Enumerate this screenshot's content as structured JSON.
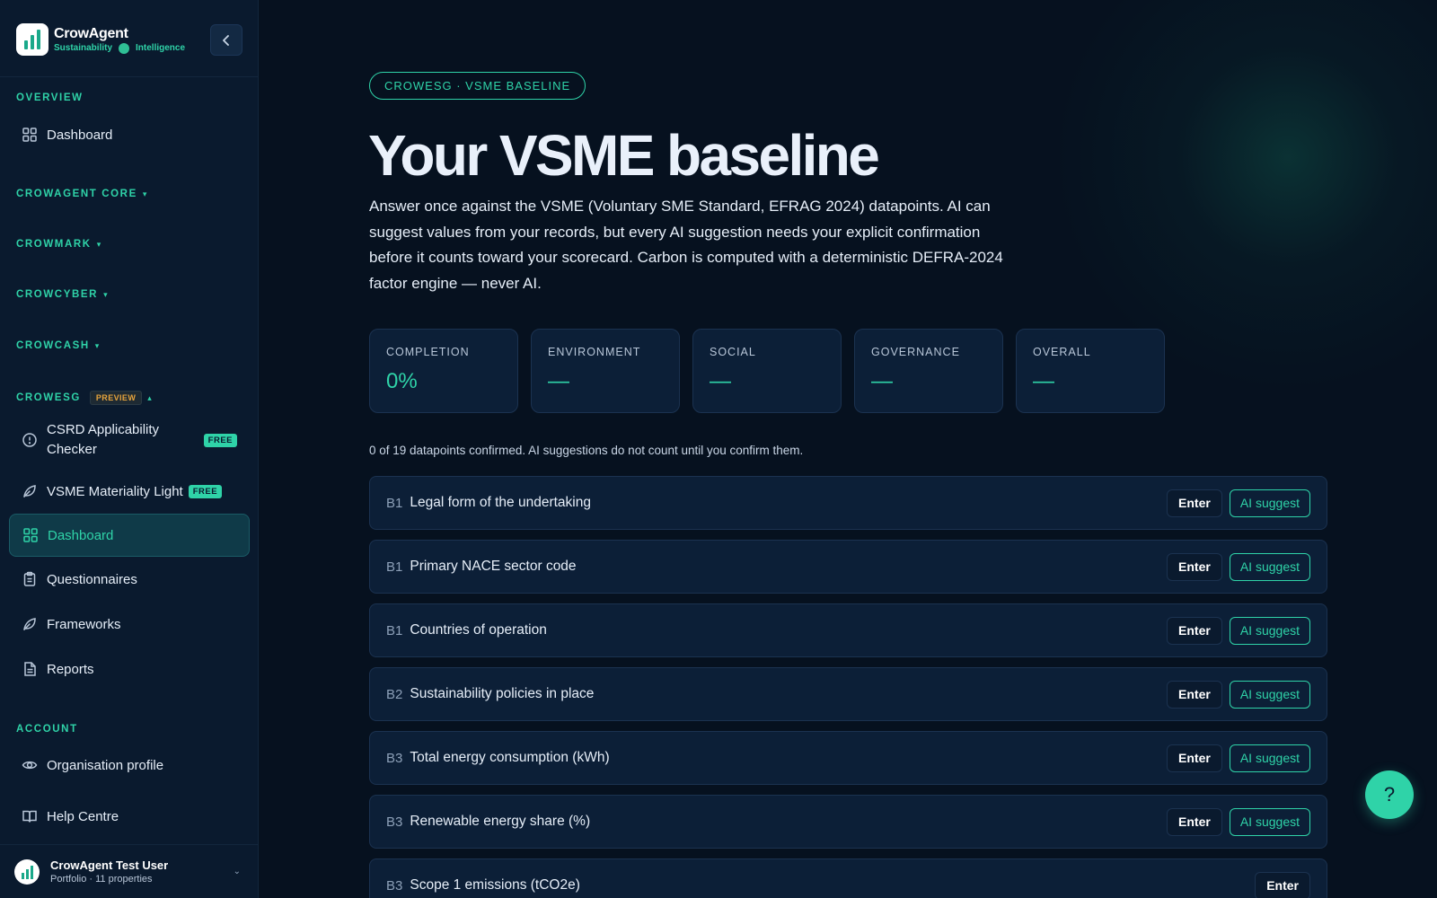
{
  "brand": {
    "name": "CrowAgent",
    "tag_left": "Sustainability",
    "tag_right": "Intelligence"
  },
  "sidebar": {
    "overview_label": "OVERVIEW",
    "overview_items": [
      {
        "label": "Dashboard",
        "icon": "grid-icon"
      }
    ],
    "groups": [
      {
        "label": "CROWAGENT CORE",
        "icon": "chevron-down-icon"
      },
      {
        "label": "CROWMARK",
        "icon": "chevron-down-icon"
      },
      {
        "label": "CROWCYBER",
        "icon": "chevron-down-icon"
      },
      {
        "label": "CROWCASH",
        "icon": "chevron-down-icon"
      }
    ],
    "crowesg": {
      "label": "CROWESG",
      "badge": "PREVIEW",
      "items": [
        {
          "label": "CSRD Applicability Checker",
          "badge": "FREE",
          "icon": "alert-circle-icon"
        },
        {
          "label": "VSME Materiality Light",
          "badge": "FREE",
          "icon": "leaf-icon"
        },
        {
          "label": "Dashboard",
          "icon": "grid-icon",
          "active": true
        },
        {
          "label": "Questionnaires",
          "icon": "clipboard-icon"
        },
        {
          "label": "Frameworks",
          "icon": "leaf-icon"
        },
        {
          "label": "Reports",
          "icon": "file-text-icon"
        }
      ]
    },
    "account_label": "ACCOUNT",
    "account_items": [
      {
        "label": "Organisation profile",
        "icon": "eye-icon"
      },
      {
        "label": "Help Centre",
        "icon": "book-icon"
      }
    ],
    "user": {
      "name": "CrowAgent Test User",
      "sub": "Portfolio · 11 properties"
    }
  },
  "main": {
    "kicker": "CROWESG · VSME BASELINE",
    "title": "Your VSME baseline",
    "lede": "Answer once against the VSME (Voluntary SME Standard, EFRAG 2024) datapoints. AI can suggest values from your records, but every AI suggestion needs your explicit confirmation before it counts toward your scorecard. Carbon is computed with a deterministic DEFRA-2024 factor engine — never AI.",
    "stats": [
      {
        "label": "COMPLETION",
        "value": "0%"
      },
      {
        "label": "ENVIRONMENT",
        "value": "—"
      },
      {
        "label": "SOCIAL",
        "value": "—"
      },
      {
        "label": "GOVERNANCE",
        "value": "—"
      },
      {
        "label": "OVERALL",
        "value": "—"
      }
    ],
    "progress_note": "0 of 19 datapoints confirmed. AI suggestions do not count until you confirm them.",
    "datapoints": [
      {
        "code": "B1",
        "label": "Legal form of the undertaking",
        "enter": "Enter",
        "ai": "AI suggest"
      },
      {
        "code": "B1",
        "label": "Primary NACE sector code",
        "enter": "Enter",
        "ai": "AI suggest"
      },
      {
        "code": "B1",
        "label": "Countries of operation",
        "enter": "Enter",
        "ai": "AI suggest"
      },
      {
        "code": "B2",
        "label": "Sustainability policies in place",
        "enter": "Enter",
        "ai": "AI suggest"
      },
      {
        "code": "B3",
        "label": "Total energy consumption (kWh)",
        "enter": "Enter",
        "ai": "AI suggest"
      },
      {
        "code": "B3",
        "label": "Renewable energy share (%)",
        "enter": "Enter",
        "ai": "AI suggest"
      },
      {
        "code": "B3",
        "label": "Scope 1 emissions (tCO2e)",
        "enter": "Enter"
      }
    ],
    "help_label": "?"
  },
  "colors": {
    "accent": "#2fd3a8",
    "background": "#06111f",
    "panel": "#0c1f37",
    "preview_badge": "#e8a53c"
  }
}
